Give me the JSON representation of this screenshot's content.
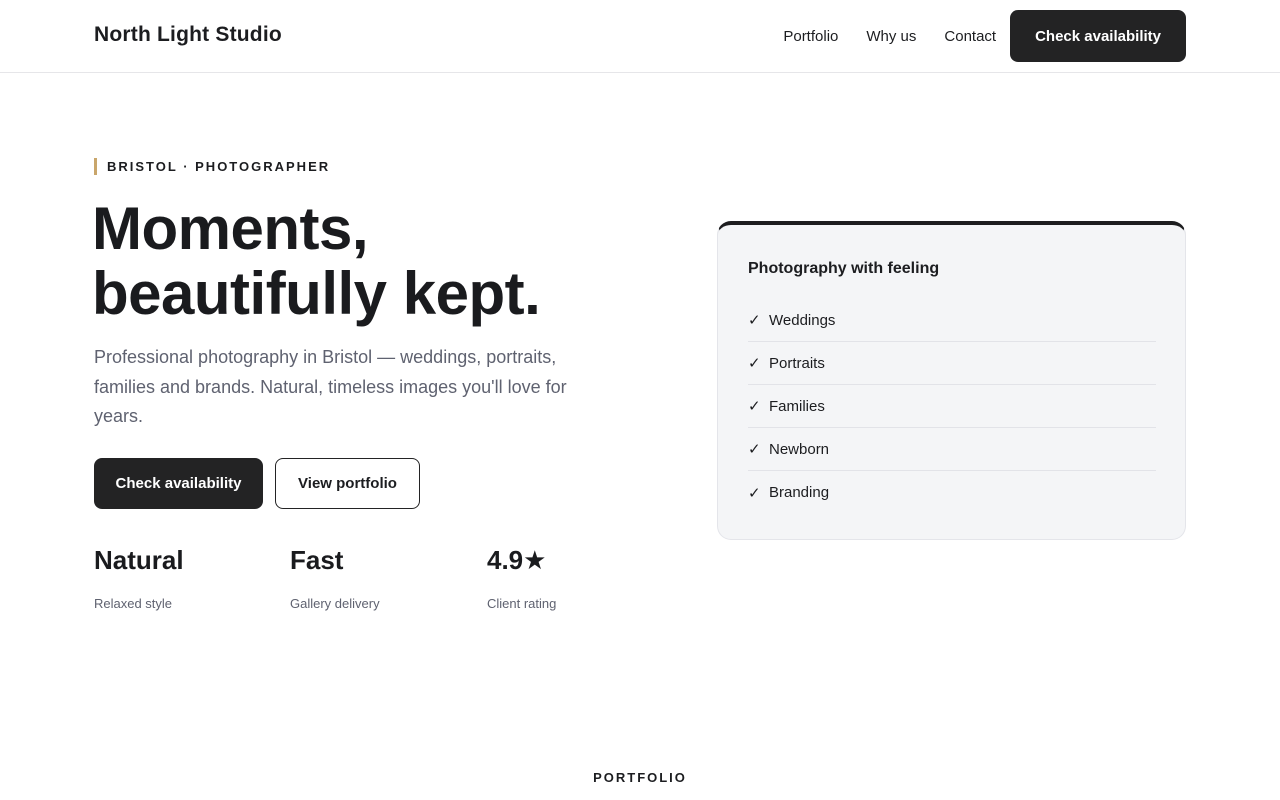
{
  "header": {
    "brand": "North Light Studio",
    "nav": [
      "Portfolio",
      "Why us",
      "Contact"
    ],
    "cta": "Check availability"
  },
  "hero": {
    "eyebrow": "BRISTOL · PHOTOGRAPHER",
    "title_line1": "Moments,",
    "title_line2": "beautifully kept.",
    "subtitle": "Professional photography in Bristol — weddings, portraits, families and brands. Natural, timeless images you'll love for years.",
    "primary_button": "Check availability",
    "secondary_button": "View portfolio",
    "stats": [
      {
        "value": "Natural",
        "label": "Relaxed style"
      },
      {
        "value": "Fast",
        "label": "Gallery delivery"
      },
      {
        "value": "4.9★",
        "label": "Client rating"
      }
    ]
  },
  "card": {
    "title": "Photography with feeling",
    "check_symbol": "✓",
    "items": [
      "Weddings",
      "Portraits",
      "Families",
      "Newborn",
      "Branding"
    ]
  },
  "next_section": {
    "label": "PORTFOLIO"
  },
  "colors": {
    "accent": "#c9a66b",
    "dark": "#232324",
    "muted_text": "#5f6270",
    "card_bg": "#f4f5f7"
  }
}
